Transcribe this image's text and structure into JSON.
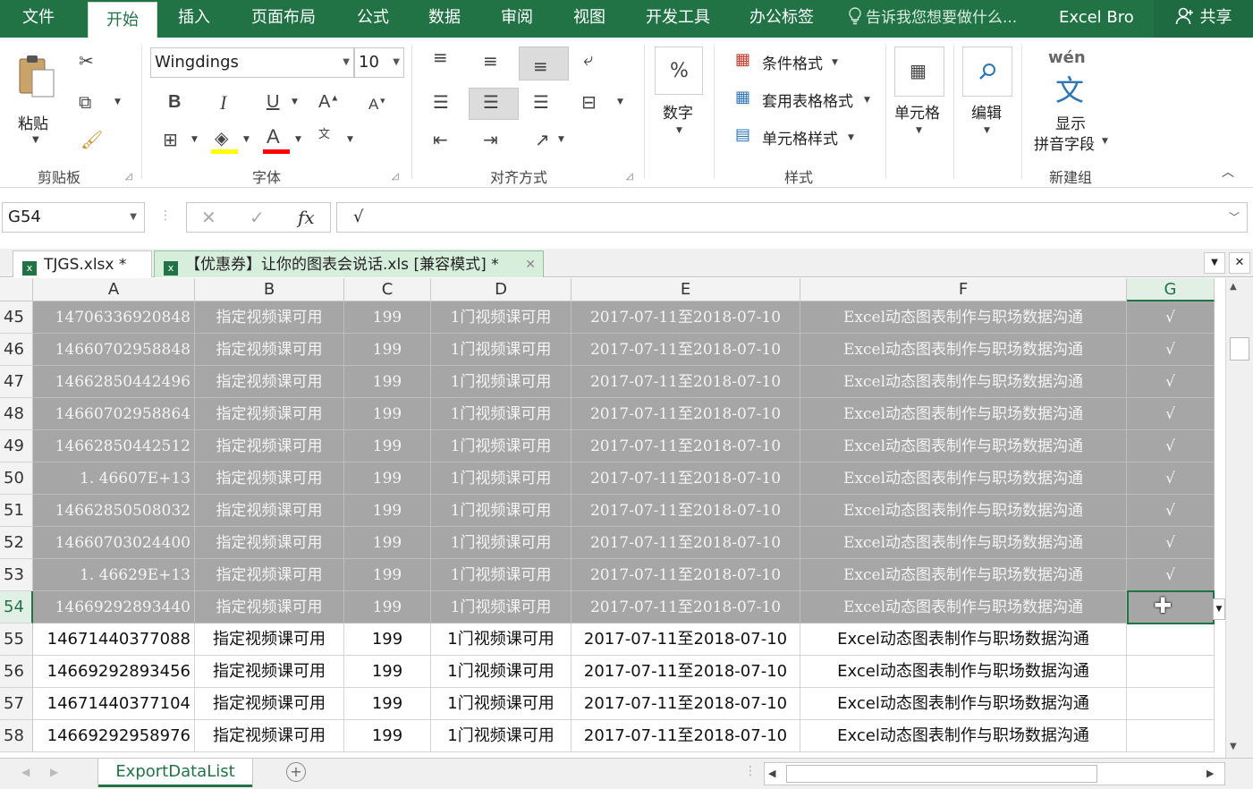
{
  "menu": {
    "tabs": [
      "文件",
      "开始",
      "插入",
      "页面布局",
      "公式",
      "数据",
      "审阅",
      "视图",
      "开发工具",
      "办公标签"
    ],
    "tell_me": "告诉我您想要做什么...",
    "user": "Excel Bro",
    "share": "共享"
  },
  "ribbon": {
    "clipboard": {
      "paste": "粘贴",
      "label": "剪贴板"
    },
    "font": {
      "name": "Wingdings",
      "size": "10",
      "bold": "B",
      "italic": "I",
      "underline": "U",
      "label": "字体",
      "grow": "A",
      "shrink": "A"
    },
    "alignment": {
      "label": "对齐方式"
    },
    "number": {
      "label": "数字",
      "icon_text": "%"
    },
    "styles": {
      "conditional": "条件格式",
      "table": "套用表格格式",
      "cell": "单元格样式",
      "label": "样式"
    },
    "cells": {
      "label": "单元格"
    },
    "editing": {
      "label": "编辑"
    },
    "phonetic": {
      "top": "wén",
      "glyph": "文",
      "line1": "显示",
      "line2": "拼音字段",
      "label": "新建组"
    }
  },
  "formula_bar": {
    "name_box": "G54",
    "fx": "fx",
    "value": "√"
  },
  "workbook_tabs": [
    {
      "name": "TJGS.xlsx *",
      "active": false
    },
    {
      "name": "【优惠券】让你的图表会说话.xls [兼容模式] *",
      "active": true
    }
  ],
  "grid": {
    "columns": [
      "A",
      "B",
      "C",
      "D",
      "E",
      "F",
      "G"
    ],
    "selected_column": "G",
    "selected_row": "54",
    "rows": [
      {
        "num": "45",
        "cells": [
          "14706336920848",
          "指定视频课可用",
          "199",
          "1门视频课可用",
          "2017-07-11至2018-07-10",
          "Excel动态图表制作与职场数据沟通",
          "√"
        ],
        "style": "gray"
      },
      {
        "num": "46",
        "cells": [
          "14660702958848",
          "指定视频课可用",
          "199",
          "1门视频课可用",
          "2017-07-11至2018-07-10",
          "Excel动态图表制作与职场数据沟通",
          "√"
        ],
        "style": "gray"
      },
      {
        "num": "47",
        "cells": [
          "14662850442496",
          "指定视频课可用",
          "199",
          "1门视频课可用",
          "2017-07-11至2018-07-10",
          "Excel动态图表制作与职场数据沟通",
          "√"
        ],
        "style": "gray"
      },
      {
        "num": "48",
        "cells": [
          "14660702958864",
          "指定视频课可用",
          "199",
          "1门视频课可用",
          "2017-07-11至2018-07-10",
          "Excel动态图表制作与职场数据沟通",
          "√"
        ],
        "style": "gray"
      },
      {
        "num": "49",
        "cells": [
          "14662850442512",
          "指定视频课可用",
          "199",
          "1门视频课可用",
          "2017-07-11至2018-07-10",
          "Excel动态图表制作与职场数据沟通",
          "√"
        ],
        "style": "gray"
      },
      {
        "num": "50",
        "cells": [
          "1. 46607E+13",
          "指定视频课可用",
          "199",
          "1门视频课可用",
          "2017-07-11至2018-07-10",
          "Excel动态图表制作与职场数据沟通",
          "√"
        ],
        "style": "gray"
      },
      {
        "num": "51",
        "cells": [
          "14662850508032",
          "指定视频课可用",
          "199",
          "1门视频课可用",
          "2017-07-11至2018-07-10",
          "Excel动态图表制作与职场数据沟通",
          "√"
        ],
        "style": "gray"
      },
      {
        "num": "52",
        "cells": [
          "14660703024400",
          "指定视频课可用",
          "199",
          "1门视频课可用",
          "2017-07-11至2018-07-10",
          "Excel动态图表制作与职场数据沟通",
          "√"
        ],
        "style": "gray"
      },
      {
        "num": "53",
        "cells": [
          "1. 46629E+13",
          "指定视频课可用",
          "199",
          "1门视频课可用",
          "2017-07-11至2018-07-10",
          "Excel动态图表制作与职场数据沟通",
          "√"
        ],
        "style": "gray"
      },
      {
        "num": "54",
        "cells": [
          "14669292893440",
          "指定视频课可用",
          "199",
          "1门视频课可用",
          "2017-07-11至2018-07-10",
          "Excel动态图表制作与职场数据沟通",
          ""
        ],
        "style": "gray"
      },
      {
        "num": "55",
        "cells": [
          "14671440377088",
          "指定视频课可用",
          "199",
          "1门视频课可用",
          "2017-07-11至2018-07-10",
          "Excel动态图表制作与职场数据沟通",
          ""
        ],
        "style": "white"
      },
      {
        "num": "56",
        "cells": [
          "14669292893456",
          "指定视频课可用",
          "199",
          "1门视频课可用",
          "2017-07-11至2018-07-10",
          "Excel动态图表制作与职场数据沟通",
          ""
        ],
        "style": "white"
      },
      {
        "num": "57",
        "cells": [
          "14671440377104",
          "指定视频课可用",
          "199",
          "1门视频课可用",
          "2017-07-11至2018-07-10",
          "Excel动态图表制作与职场数据沟通",
          ""
        ],
        "style": "white"
      },
      {
        "num": "58",
        "cells": [
          "14669292958976",
          "指定视频课可用",
          "199",
          "1门视频课可用",
          "2017-07-11至2018-07-10",
          "Excel动态图表制作与职场数据沟通",
          ""
        ],
        "style": "white"
      }
    ]
  },
  "sheet_tab": "ExportDataList",
  "colors": {
    "brand": "#217346",
    "selection_fill": "#a6a6a6",
    "underline_bar": "#ff0000",
    "highlight_bar": "#ffff00"
  }
}
